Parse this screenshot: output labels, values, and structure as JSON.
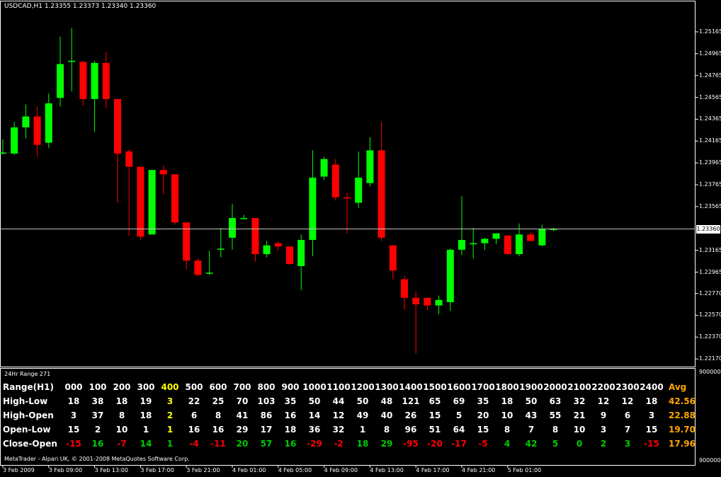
{
  "window": {
    "symbol_ohlc": "USDCAD,H1  1.23355 1.23373 1.23340 1.23360",
    "indicator_label": "24Hr Range 271",
    "footer_credit": "MetaTrader - Alpari UK, © 2001-2008 MetaQuotes Software Corp."
  },
  "price_axis": {
    "labels": [
      "1.25165",
      "1.24965",
      "1.24765",
      "1.24565",
      "1.24365",
      "1.24165",
      "1.23965",
      "1.23765",
      "1.23565",
      "1.23165",
      "1.22965",
      "1.22770",
      "1.22570",
      "1.22370",
      "1.22170"
    ],
    "current_price": "1.23360",
    "indicator_top": "9000000",
    "indicator_bottom": "9000000"
  },
  "time_axis": {
    "labels": [
      "3 Feb 2009",
      "3 Feb 09:00",
      "3 Feb 13:00",
      "3 Feb 17:00",
      "3 Feb 21:00",
      "4 Feb 01:00",
      "4 Feb 05:00",
      "4 Feb 09:00",
      "4 Feb 13:00",
      "4 Feb 17:00",
      "4 Feb 21:00",
      "5 Feb 01:00"
    ]
  },
  "table": {
    "header_label": "Range(H1)",
    "hours": [
      "000",
      "100",
      "200",
      "300",
      "400",
      "500",
      "600",
      "700",
      "800",
      "900",
      "1000",
      "1100",
      "1200",
      "1300",
      "1400",
      "1500",
      "1600",
      "1700",
      "1800",
      "1900",
      "2000",
      "2100",
      "2200",
      "2300",
      "2400"
    ],
    "avg_label": "Avg",
    "highlight_hour_index": 4,
    "rows": [
      {
        "label": "High-Low",
        "values": [
          "18",
          "38",
          "18",
          "19",
          "3",
          "22",
          "25",
          "70",
          "103",
          "35",
          "50",
          "44",
          "50",
          "48",
          "121",
          "65",
          "69",
          "35",
          "18",
          "50",
          "63",
          "32",
          "12",
          "12",
          "18"
        ],
        "avg": "42.56"
      },
      {
        "label": "High-Open",
        "values": [
          "3",
          "37",
          "8",
          "18",
          "2",
          "6",
          "8",
          "41",
          "86",
          "16",
          "14",
          "12",
          "49",
          "40",
          "26",
          "15",
          "5",
          "20",
          "10",
          "43",
          "55",
          "21",
          "9",
          "6",
          "3"
        ],
        "avg": "22.88"
      },
      {
        "label": "Open-Low",
        "values": [
          "15",
          "2",
          "10",
          "1",
          "1",
          "16",
          "16",
          "29",
          "17",
          "18",
          "36",
          "32",
          "1",
          "8",
          "96",
          "51",
          "64",
          "15",
          "8",
          "7",
          "8",
          "10",
          "3",
          "7",
          "15"
        ],
        "avg": "19.70"
      },
      {
        "label": "Close-Open",
        "values": [
          "-15",
          "16",
          "-7",
          "14",
          "1",
          "-4",
          "-11",
          "20",
          "57",
          "16",
          "-29",
          "-2",
          "18",
          "29",
          "-95",
          "-20",
          "-17",
          "-5",
          "4",
          "42",
          "5",
          "0",
          "2",
          "3",
          "-15"
        ],
        "avg": "17.96"
      }
    ]
  },
  "colors": {
    "bull": "#00ff00",
    "bear": "#ff0000",
    "highlight": "#ffff00",
    "avg": "#ffa500",
    "positive_text": "#00cc00",
    "negative_text": "#ff0000",
    "neutral_text": "#ffffff",
    "grid_line": "#c0c0c0"
  },
  "chart_data": {
    "type": "candlestick",
    "symbol": "USDCAD",
    "timeframe": "H1",
    "ylim": [
      1.221,
      1.2545
    ],
    "current_price": 1.2336,
    "candles": [
      {
        "o": 1.2406,
        "h": 1.2418,
        "l": 1.2404,
        "c": 1.2406
      },
      {
        "o": 1.2405,
        "h": 1.2434,
        "l": 1.2404,
        "c": 1.2429
      },
      {
        "o": 1.2429,
        "h": 1.245,
        "l": 1.2419,
        "c": 1.2439
      },
      {
        "o": 1.2439,
        "h": 1.2448,
        "l": 1.2402,
        "c": 1.2413
      },
      {
        "o": 1.2415,
        "h": 1.246,
        "l": 1.241,
        "c": 1.2451
      },
      {
        "o": 1.2456,
        "h": 1.2512,
        "l": 1.2448,
        "c": 1.2487
      },
      {
        "o": 1.2489,
        "h": 1.252,
        "l": 1.2462,
        "c": 1.249
      },
      {
        "o": 1.2489,
        "h": 1.249,
        "l": 1.2449,
        "c": 1.2455
      },
      {
        "o": 1.2455,
        "h": 1.249,
        "l": 1.2425,
        "c": 1.2488
      },
      {
        "o": 1.2488,
        "h": 1.2498,
        "l": 1.2447,
        "c": 1.2455
      },
      {
        "o": 1.2455,
        "h": 1.2455,
        "l": 1.236,
        "c": 1.2405
      },
      {
        "o": 1.2407,
        "h": 1.2409,
        "l": 1.233,
        "c": 1.2393
      },
      {
        "o": 1.2393,
        "h": 1.2393,
        "l": 1.2326,
        "c": 1.2329
      },
      {
        "o": 1.2331,
        "h": 1.239,
        "l": 1.2331,
        "c": 1.239
      },
      {
        "o": 1.239,
        "h": 1.2394,
        "l": 1.2368,
        "c": 1.2386
      },
      {
        "o": 1.2386,
        "h": 1.2386,
        "l": 1.234,
        "c": 1.2342
      },
      {
        "o": 1.2342,
        "h": 1.2342,
        "l": 1.2299,
        "c": 1.2307
      },
      {
        "o": 1.2307,
        "h": 1.2309,
        "l": 1.2293,
        "c": 1.2294
      },
      {
        "o": 1.2296,
        "h": 1.2316,
        "l": 1.2294,
        "c": 1.2296
      },
      {
        "o": 1.2318,
        "h": 1.2337,
        "l": 1.231,
        "c": 1.2318
      },
      {
        "o": 1.2328,
        "h": 1.2359,
        "l": 1.2317,
        "c": 1.2346
      },
      {
        "o": 1.2346,
        "h": 1.2349,
        "l": 1.2345,
        "c": 1.2346
      },
      {
        "o": 1.2346,
        "h": 1.2346,
        "l": 1.2306,
        "c": 1.2313
      },
      {
        "o": 1.2313,
        "h": 1.2325,
        "l": 1.231,
        "c": 1.2321
      },
      {
        "o": 1.2323,
        "h": 1.2325,
        "l": 1.2316,
        "c": 1.232
      },
      {
        "o": 1.232,
        "h": 1.232,
        "l": 1.2303,
        "c": 1.2304
      },
      {
        "o": 1.2302,
        "h": 1.2331,
        "l": 1.228,
        "c": 1.2326
      },
      {
        "o": 1.2326,
        "h": 1.2408,
        "l": 1.2311,
        "c": 1.2383
      },
      {
        "o": 1.2384,
        "h": 1.2402,
        "l": 1.2381,
        "c": 1.24
      },
      {
        "o": 1.2395,
        "h": 1.24,
        "l": 1.2362,
        "c": 1.2365
      },
      {
        "o": 1.2365,
        "h": 1.2369,
        "l": 1.2332,
        "c": 1.2364
      },
      {
        "o": 1.236,
        "h": 1.2407,
        "l": 1.2355,
        "c": 1.2383
      },
      {
        "o": 1.2378,
        "h": 1.242,
        "l": 1.2375,
        "c": 1.2408
      },
      {
        "o": 1.2408,
        "h": 1.2434,
        "l": 1.2325,
        "c": 1.2328
      },
      {
        "o": 1.2321,
        "h": 1.2321,
        "l": 1.229,
        "c": 1.2298
      },
      {
        "o": 1.229,
        "h": 1.2293,
        "l": 1.2262,
        "c": 1.2273
      },
      {
        "o": 1.2273,
        "h": 1.2279,
        "l": 1.2222,
        "c": 1.2267
      },
      {
        "o": 1.2273,
        "h": 1.2273,
        "l": 1.2262,
        "c": 1.2266
      },
      {
        "o": 1.2266,
        "h": 1.2275,
        "l": 1.2258,
        "c": 1.2271
      },
      {
        "o": 1.2269,
        "h": 1.2318,
        "l": 1.2261,
        "c": 1.2317
      },
      {
        "o": 1.2317,
        "h": 1.2366,
        "l": 1.2312,
        "c": 1.2326
      },
      {
        "o": 1.2322,
        "h": 1.2337,
        "l": 1.2309,
        "c": 1.2323
      },
      {
        "o": 1.2323,
        "h": 1.2328,
        "l": 1.2317,
        "c": 1.2327
      },
      {
        "o": 1.2327,
        "h": 1.2332,
        "l": 1.2322,
        "c": 1.2332
      },
      {
        "o": 1.233,
        "h": 1.233,
        "l": 1.2313,
        "c": 1.2313
      },
      {
        "o": 1.2313,
        "h": 1.2341,
        "l": 1.2311,
        "c": 1.2331
      },
      {
        "o": 1.2331,
        "h": 1.2333,
        "l": 1.2325,
        "c": 1.2325
      },
      {
        "o": 1.2321,
        "h": 1.234,
        "l": 1.232,
        "c": 1.2336
      },
      {
        "o": 1.2336,
        "h": 1.2337,
        "l": 1.2334,
        "c": 1.2336
      }
    ]
  }
}
